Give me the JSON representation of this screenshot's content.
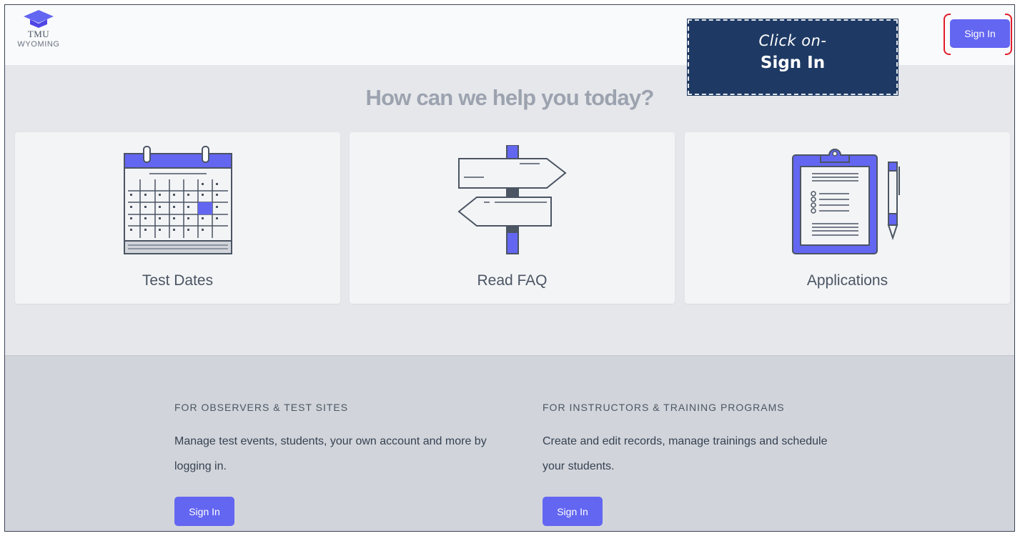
{
  "brand": {
    "line1": "TMU",
    "line2": "WYOMING"
  },
  "header": {
    "sign_in_label": "Sign In"
  },
  "callout": {
    "line1": "Click on-",
    "line2": "Sign In"
  },
  "main": {
    "heading": "How can we help you today?",
    "cards": [
      {
        "label": "Test Dates",
        "icon": "calendar-icon"
      },
      {
        "label": "Read FAQ",
        "icon": "signpost-icon"
      },
      {
        "label": "Applications",
        "icon": "clipboard-icon"
      }
    ]
  },
  "footer": {
    "columns": [
      {
        "heading": "FOR OBSERVERS & TEST SITES",
        "text": "Manage test events, students, your own account and more by logging in.",
        "button": "Sign In"
      },
      {
        "heading": "FOR INSTRUCTORS & TRAINING PROGRAMS",
        "text": "Create and edit records, manage trainings and schedule your students.",
        "button": "Sign In"
      }
    ]
  },
  "colors": {
    "accent": "#6366f1",
    "callout": "#1e3a64",
    "highlight": "#e11d2a"
  }
}
